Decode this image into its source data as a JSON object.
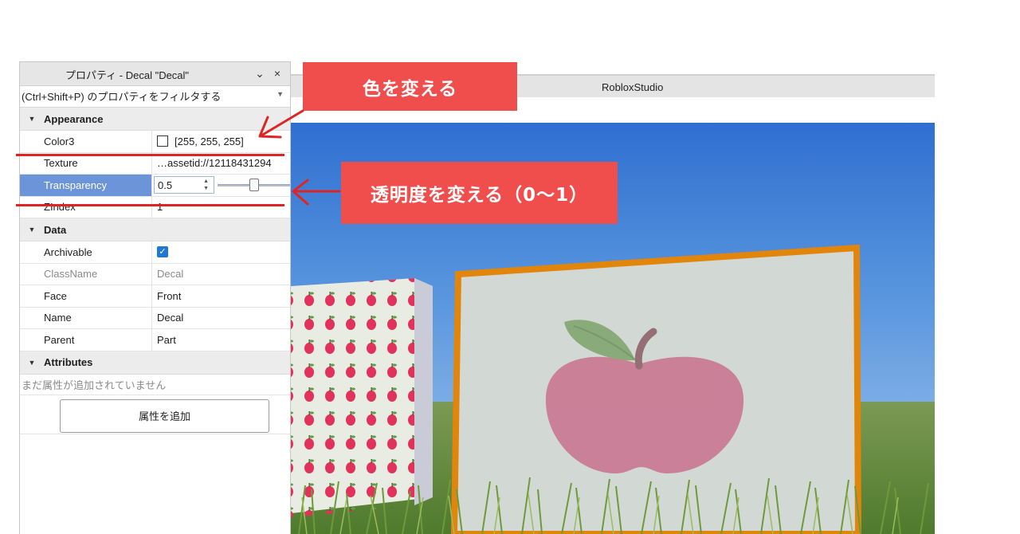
{
  "panel": {
    "title": "プロパティ - Decal \"Decal\"",
    "collapse_icon": "chevron-down-icon",
    "close_icon": "close-icon",
    "filter_placeholder": "(Ctrl+Shift+P) のプロパティをフィルタする",
    "sections": {
      "appearance": "Appearance",
      "data": "Data",
      "attributes": "Attributes"
    },
    "appearance_rows": {
      "color3": {
        "name": "Color3",
        "value": "[255, 255, 255]"
      },
      "texture": {
        "name": "Texture",
        "value": "…assetid://12118431294"
      },
      "transparency": {
        "name": "Transparency",
        "value": "0.5",
        "slider_fraction": 0.5
      },
      "zindex": {
        "name": "ZIndex",
        "value": "1"
      }
    },
    "data_rows": {
      "archivable": {
        "name": "Archivable",
        "checked": true
      },
      "classname": {
        "name": "ClassName",
        "value": "Decal"
      },
      "face": {
        "name": "Face",
        "value": "Front"
      },
      "name": {
        "name": "Name",
        "value": "Decal"
      },
      "parent": {
        "name": "Parent",
        "value": "Part"
      }
    },
    "attributes_empty": "まだ属性が追加されていません",
    "add_attribute_label": "属性を追加"
  },
  "studio": {
    "window_title": "RobloxStudio"
  },
  "callouts": {
    "color": "色を変える",
    "transparency": "透明度を変える（0〜1）"
  },
  "colors": {
    "callout": "#f04d4d",
    "selection": "#6b95d8",
    "frame_border": "#e2850b",
    "apple": "#c9718d",
    "leaf": "#7da46b"
  }
}
